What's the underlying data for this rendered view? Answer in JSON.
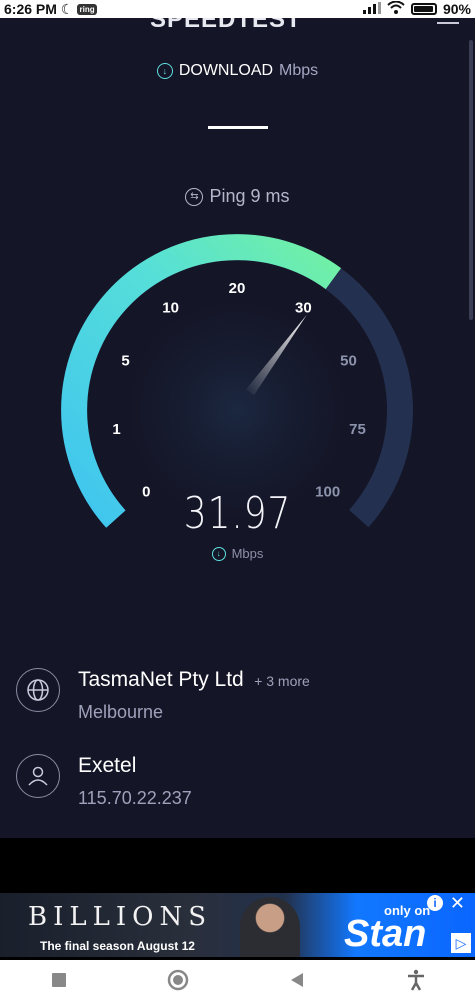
{
  "status_bar": {
    "time": "6:26 PM",
    "notif_badge": "ring",
    "battery": "90%"
  },
  "app": {
    "title": "SPEEDTEST"
  },
  "test": {
    "mode_label": "DOWNLOAD",
    "mode_unit": "Mbps",
    "ping_label": "Ping 9 ms",
    "speed_value": "31.97",
    "speed_unit": "Mbps",
    "gauge_reading": 31.97,
    "gauge_ticks": [
      "0",
      "1",
      "5",
      "10",
      "20",
      "30",
      "50",
      "75",
      "100"
    ]
  },
  "server": {
    "name": "TasmaNet Pty Ltd",
    "more": "+ 3 more",
    "location": "Melbourne"
  },
  "provider": {
    "name": "Exetel",
    "ip": "115.70.22.237"
  },
  "ad": {
    "title": "BILLIONS",
    "tagline": "The final season August 12",
    "brand_small": "only on",
    "brand": "Stan"
  },
  "colors": {
    "background": "#141526",
    "gauge_cyan": "#4ed7ef",
    "gauge_green": "#6ff0a4",
    "gauge_track": "#23304f"
  }
}
